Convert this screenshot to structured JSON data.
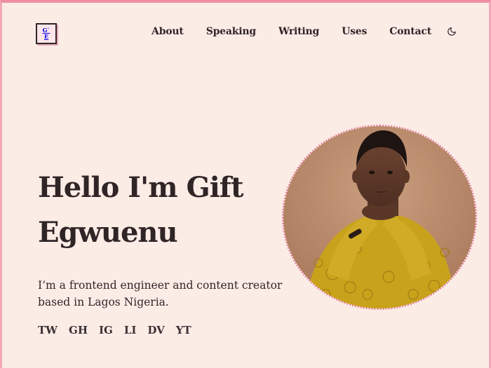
{
  "logo": {
    "line1": "G`",
    "line2": "E"
  },
  "nav": {
    "items": [
      "About",
      "Speaking",
      "Writing",
      "Uses",
      "Contact"
    ],
    "theme_toggle_icon": "moon-icon"
  },
  "hero": {
    "title": "Hello I'm Gift Egwuenu",
    "intro": "I’m a frontend engineer and content creator based in Lagos Nigeria.",
    "photo_alt": "Portrait of Gift Egwuenu"
  },
  "socials": [
    "TW",
    "GH",
    "IG",
    "LI",
    "DV",
    "YT"
  ],
  "colors": {
    "background": "#fcece6",
    "text": "#2f2527",
    "accent_pink": "#f08ea6",
    "photo_ring": "#e07a98",
    "mustard": "#c9a21c"
  }
}
